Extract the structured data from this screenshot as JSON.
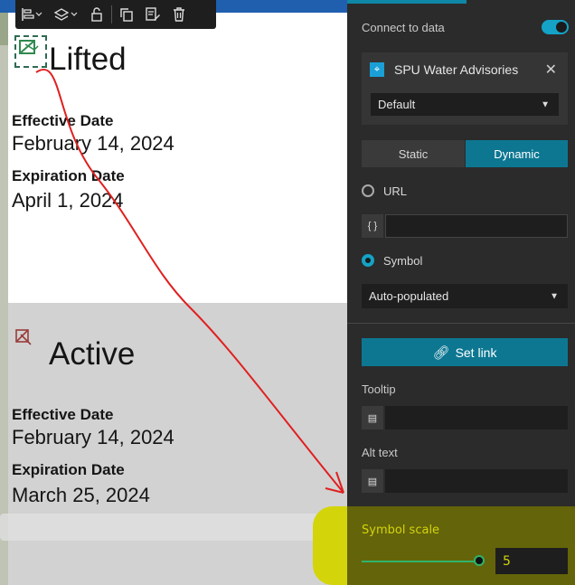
{
  "toolbar": {
    "icons": [
      "align-icon",
      "layers-icon",
      "lock-icon",
      "duplicate-icon",
      "edit-icon",
      "delete-icon"
    ]
  },
  "cards": [
    {
      "status": "Lifted",
      "effective_label": "Effective Date",
      "effective_value": "February 14, 2024",
      "expiration_label": "Expiration Date",
      "expiration_value": "April 1, 2024"
    },
    {
      "status": "Active",
      "effective_label": "Effective Date",
      "effective_value": "February 14, 2024",
      "expiration_label": "Expiration Date",
      "expiration_value": "March 25, 2024"
    }
  ],
  "panel": {
    "connect_label": "Connect to data",
    "connect_on": true,
    "datasource_name": "SPU Water Advisories",
    "view_select": "Default",
    "segments": [
      "Static",
      "Dynamic"
    ],
    "active_segment": "Dynamic",
    "url_label": "URL",
    "expr_chip": "{ }",
    "symbol_label": "Symbol",
    "symbol_select": "Auto-populated",
    "set_link_label": "Set link",
    "tooltip_label": "Tooltip",
    "alt_text_label": "Alt text",
    "symbol_scale_label": "Symbol scale",
    "symbol_scale_value": "5",
    "accent_color": "#0d7792",
    "highlight_color": "#d4d40a"
  }
}
